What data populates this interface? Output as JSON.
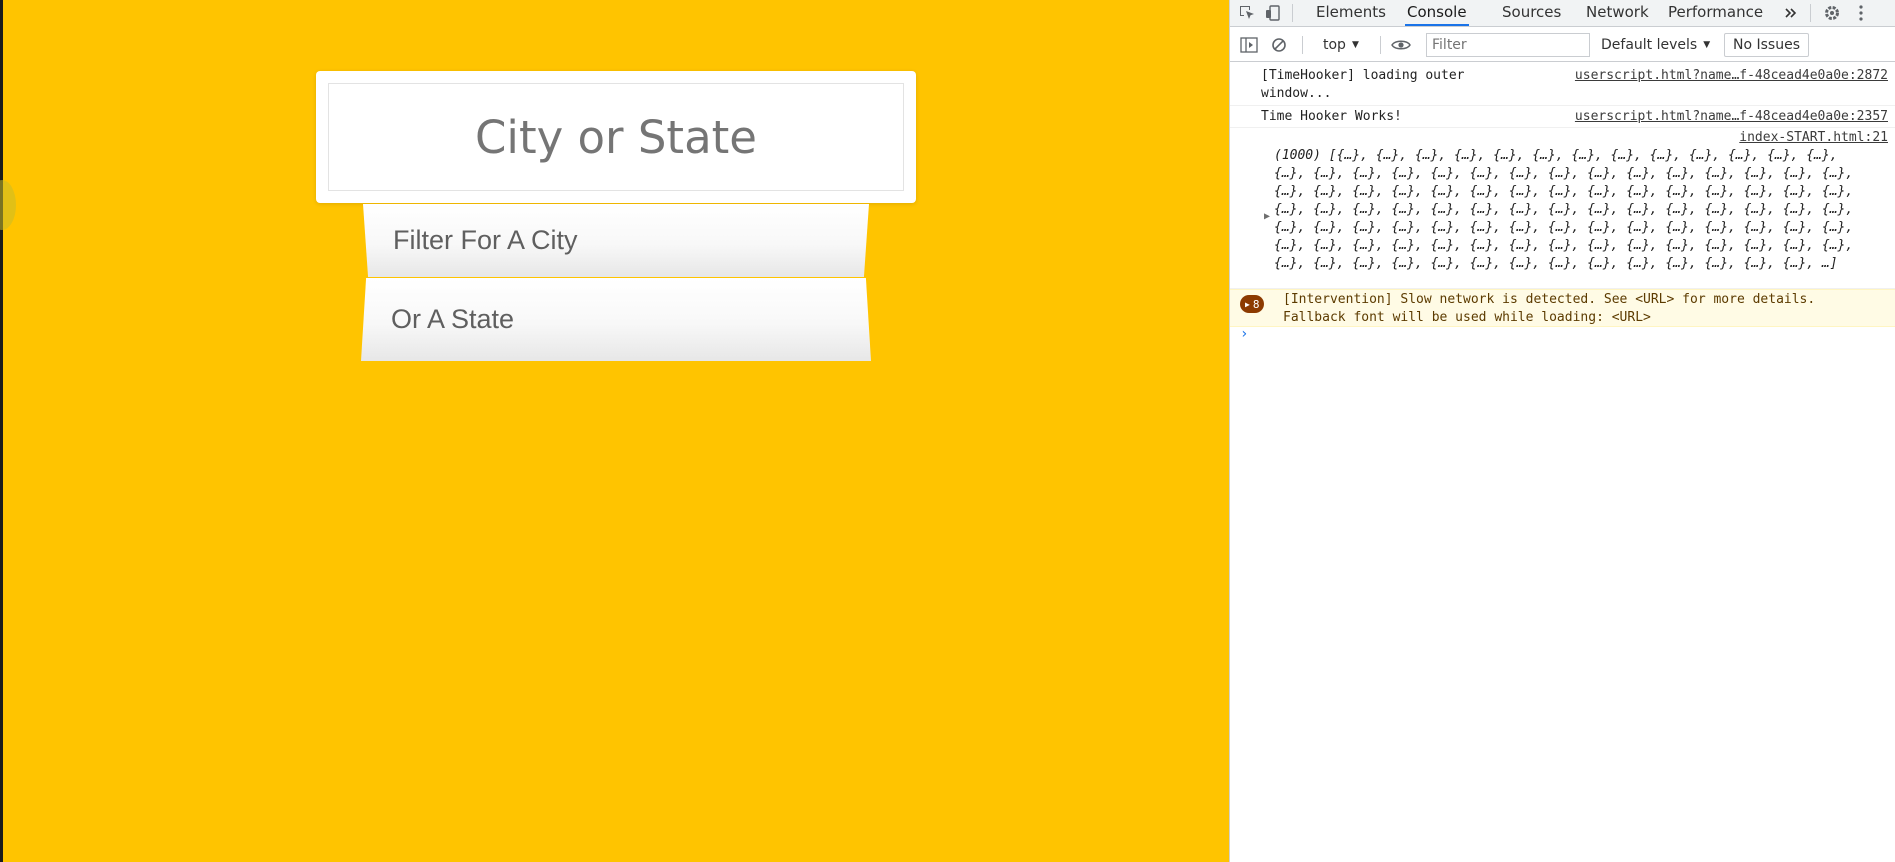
{
  "page": {
    "search_placeholder": "City or State",
    "suggestions": [
      "Filter For A City",
      "Or A State"
    ]
  },
  "devtools": {
    "tabs": [
      "Elements",
      "Console",
      "Sources",
      "Network",
      "Performance"
    ],
    "active_tab": "Console",
    "icons": {
      "inspect": "inspect-element-icon",
      "device": "device-toolbar-icon",
      "more_tabs": "double-chevron-icon",
      "settings": "gear-icon",
      "menu": "kebab-menu-icon",
      "sidebar": "sidebar-toggle-icon",
      "clear": "clear-console-icon",
      "eye": "live-expression-eye-icon"
    },
    "toolbar": {
      "context": "top",
      "filter_placeholder": "Filter",
      "levels": "Default levels",
      "issues": "No Issues"
    },
    "console": {
      "messages": [
        {
          "text": "[TimeHooker] loading outer\nwindow...",
          "source": "userscript.html?name…f-48cead4e0a0e:2872"
        },
        {
          "text": "Time Hooker Works!",
          "source": "userscript.html?name…f-48cead4e0a0e:2357"
        },
        {
          "text": "(1000) [{…}, {…}, {…}, {…}, {…}, {…}, {…}, {…}, {…}, {…}, {…}, {…}, {…},\n{…}, {…}, {…}, {…}, {…}, {…}, {…}, {…}, {…}, {…}, {…}, {…}, {…}, {…}, {…},\n{…}, {…}, {…}, {…}, {…}, {…}, {…}, {…}, {…}, {…}, {…}, {…}, {…}, {…}, {…},\n{…}, {…}, {…}, {…}, {…}, {…}, {…}, {…}, {…}, {…}, {…}, {…}, {…}, {…}, {…},\n{…}, {…}, {…}, {…}, {…}, {…}, {…}, {…}, {…}, {…}, {…}, {…}, {…}, {…}, {…},\n{…}, {…}, {…}, {…}, {…}, {…}, {…}, {…}, {…}, {…}, {…}, {…}, {…}, {…}, {…},\n{…}, {…}, {…}, {…}, {…}, {…}, {…}, {…}, {…}, {…}, {…}, {…}, {…}, {…}, …]",
          "source": "index-START.html:21"
        }
      ],
      "warning": {
        "count": "8",
        "text": "[Intervention] Slow network is detected. See <URL> for more details.\nFallback font will be used while loading: <URL>"
      },
      "prompt": "›"
    }
  }
}
